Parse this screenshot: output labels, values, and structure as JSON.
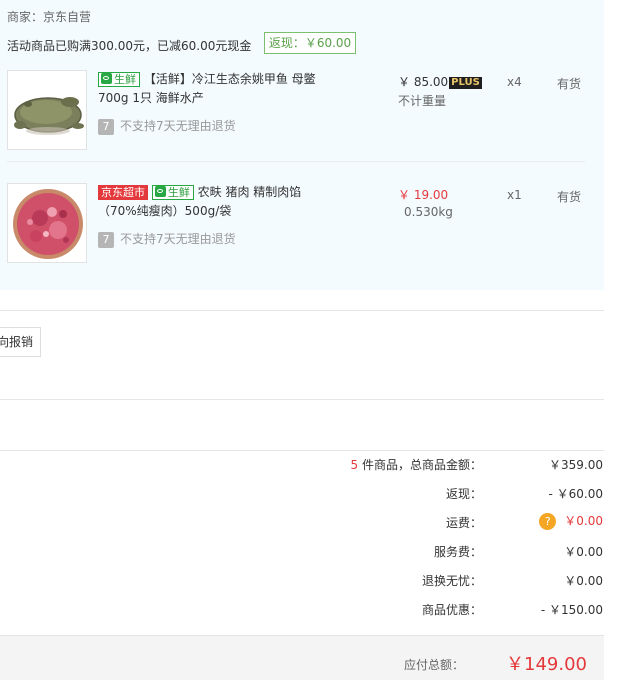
{
  "order": {
    "merchant_label": "商家：京东自营",
    "promo_text": "活动商品已购满300.00元，已减60.00元现金",
    "cashback_badge": "返现：￥60.00",
    "items": [
      {
        "tags": [
          "生鲜"
        ],
        "title": "【活鲜】冷江生态余姚甲鱼 母鳖700g 1只 海鲜水产",
        "return_policy": "不支持7天无理由退货",
        "return_icon_text": "7",
        "price": "￥ 85.00",
        "plus_badge": "PLUS",
        "sub_text": "不计重量",
        "qty": "x4",
        "stock": "有货",
        "thumb_icon": "soft-shell-turtle-image"
      },
      {
        "tags": [
          "京东超市",
          "生鲜"
        ],
        "title": "农畉 猪肉 精制肉馅（70%纯瘦肉）500g/袋",
        "return_policy": "不支持7天无理由退货",
        "return_icon_text": "7",
        "price": "￥ 19.00",
        "sub_text": "0.530kg",
        "qty": "x1",
        "stock": "有货",
        "thumb_icon": "minced-pork-image"
      }
    ]
  },
  "expense_button_label": "向报销",
  "summary": {
    "count": "5",
    "count_suffix": " 件商品，总商品金额：",
    "rows": [
      {
        "label": "返现：",
        "value": "- ￥60.00"
      },
      {
        "label": "运费：",
        "value": "￥0.00",
        "help_icon": "?"
      },
      {
        "label": "服务费：",
        "value": "￥0.00"
      },
      {
        "label": "退换无忧：",
        "value": "￥0.00"
      },
      {
        "label": "商品优惠：",
        "value": "- ￥150.00"
      }
    ],
    "total_amount": "￥359.00",
    "payable_label": "应付总额：",
    "payable_value": "￥149.00"
  },
  "colors": {
    "accent_red": "#e4393c",
    "fresh_green": "#28a745",
    "panel_bg": "#f3fbfe",
    "help_orange": "#f5a623"
  }
}
